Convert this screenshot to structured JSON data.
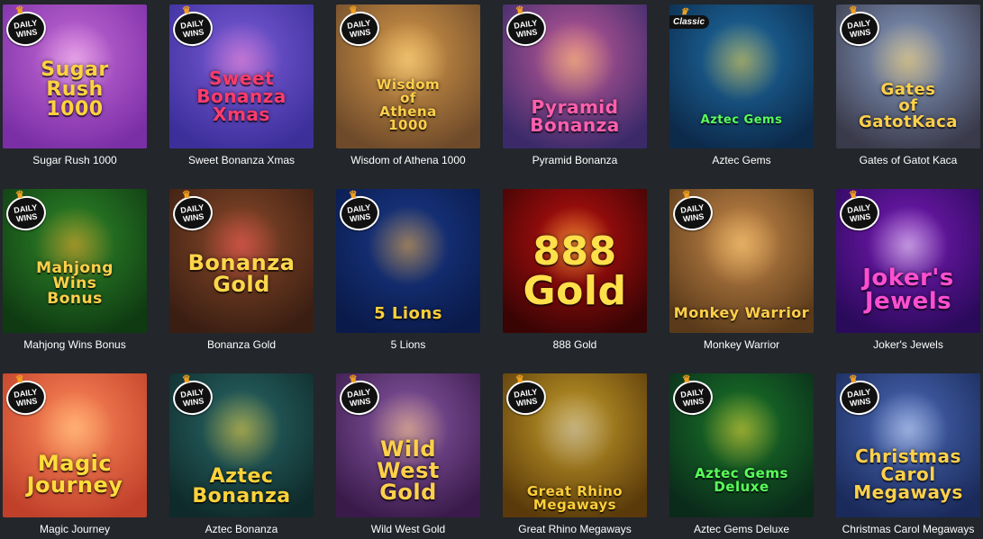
{
  "badges": {
    "daily_line1": "DAILY",
    "daily_line2": "WINS",
    "classic": "Classic",
    "crown_icon": "crown-icon"
  },
  "games": [
    {
      "title": "Sugar Rush 1000",
      "logo": "Sugar\nRush\n1000",
      "badge": "daily",
      "bg1": "#c66ad6",
      "bg2": "#7a2fa6",
      "glow": "#ffd1f3",
      "logo_color": "#ffd23e"
    },
    {
      "title": "Sweet Bonanza Xmas",
      "logo": "Sweet\nBonanza\nXmas",
      "badge": "daily",
      "bg1": "#7a5cd8",
      "bg2": "#3c2f9a",
      "glow": "#ff8bd0",
      "logo_color": "#ff3b6b"
    },
    {
      "title": "Wisdom of Athena 1000",
      "logo": "Wisdom\nof\nAthena\n1000",
      "badge": "daily",
      "bg1": "#d79a4a",
      "bg2": "#6e4a2a",
      "glow": "#ffe08a",
      "logo_color": "#ffcf4a"
    },
    {
      "title": "Pyramid Bonanza",
      "logo": "Pyramid\nBonanza",
      "badge": "daily",
      "bg1": "#c45a9a",
      "bg2": "#3a2a6a",
      "glow": "#ffd36a",
      "logo_color": "#ff5fae"
    },
    {
      "title": "Aztec Gems",
      "logo": "Aztec Gems",
      "badge": "classic",
      "bg1": "#1f6fa8",
      "bg2": "#0c2a4a",
      "glow": "#ffd23a",
      "logo_color": "#5aff5a"
    },
    {
      "title": "Gates of Gatot Kaca",
      "logo": "Gates\nof\nGatotKaca",
      "badge": "daily",
      "bg1": "#8aa0c8",
      "bg2": "#3a3a4a",
      "glow": "#ffcf5a",
      "logo_color": "#ffd04a"
    },
    {
      "title": "Mahjong Wins Bonus",
      "logo": "Mahjong\nWins\nBonus",
      "badge": "daily",
      "bg1": "#2f8a2a",
      "bg2": "#0f3a12",
      "glow": "#ff9d2a",
      "logo_color": "#ffd04a"
    },
    {
      "title": "Bonanza Gold",
      "logo": "Bonanza\nGold",
      "badge": "daily",
      "bg1": "#8a4a2a",
      "bg2": "#3a1e12",
      "glow": "#ff5a5a",
      "logo_color": "#ffd64a"
    },
    {
      "title": "5 Lions",
      "logo": "5 Lions",
      "badge": "daily",
      "bg1": "#1a3a8a",
      "bg2": "#0a1a4a",
      "glow": "#ffb43a",
      "logo_color": "#ffcf3a"
    },
    {
      "title": "888 Gold",
      "logo": "888\nGold",
      "badge": "none",
      "bg1": "#c01010",
      "bg2": "#3a0404",
      "glow": "#ffe04a",
      "logo_color": "#ffe04a"
    },
    {
      "title": "Monkey Warrior",
      "logo": "Monkey Warrior",
      "badge": "daily",
      "bg1": "#c88a4a",
      "bg2": "#5a3a1a",
      "glow": "#ffcf7a",
      "logo_color": "#ffd04a"
    },
    {
      "title": "Joker's Jewels",
      "logo": "Joker's\nJewels",
      "badge": "daily",
      "bg1": "#7a1ab8",
      "bg2": "#2a0a5a",
      "glow": "#ffffff",
      "logo_color": "#ff4fd0"
    },
    {
      "title": "Magic Journey",
      "logo": "Magic\nJourney",
      "badge": "daily",
      "bg1": "#ff8a5a",
      "bg2": "#c0402a",
      "glow": "#ffd08a",
      "logo_color": "#ffdc3a"
    },
    {
      "title": "Aztec Bonanza",
      "logo": "Aztec\nBonanza",
      "badge": "daily",
      "bg1": "#2a6a6a",
      "bg2": "#0f2a2a",
      "glow": "#ffd23a",
      "logo_color": "#ffd23a"
    },
    {
      "title": "Wild West Gold",
      "logo": "Wild\nWest\nGold",
      "badge": "daily",
      "bg1": "#8a5aa8",
      "bg2": "#3a1a4a",
      "glow": "#ffcf7a",
      "logo_color": "#ffd04a"
    },
    {
      "title": "Great Rhino Megaways",
      "logo": "Great Rhino\nMegaways",
      "badge": "daily",
      "bg1": "#c8a02a",
      "bg2": "#5a3a0a",
      "glow": "#c0c0c8",
      "logo_color": "#ffcf3a"
    },
    {
      "title": "Aztec Gems Deluxe",
      "logo": "Aztec Gems\nDeluxe",
      "badge": "daily",
      "bg1": "#1a7a2a",
      "bg2": "#0a2a1a",
      "glow": "#ffd23a",
      "logo_color": "#5aff5a"
    },
    {
      "title": "Christmas Carol Megaways",
      "logo": "Christmas\nCarol\nMegaways",
      "badge": "daily",
      "bg1": "#4a6ab8",
      "bg2": "#1a2a5a",
      "glow": "#dfe8ff",
      "logo_color": "#ffd04a"
    }
  ]
}
